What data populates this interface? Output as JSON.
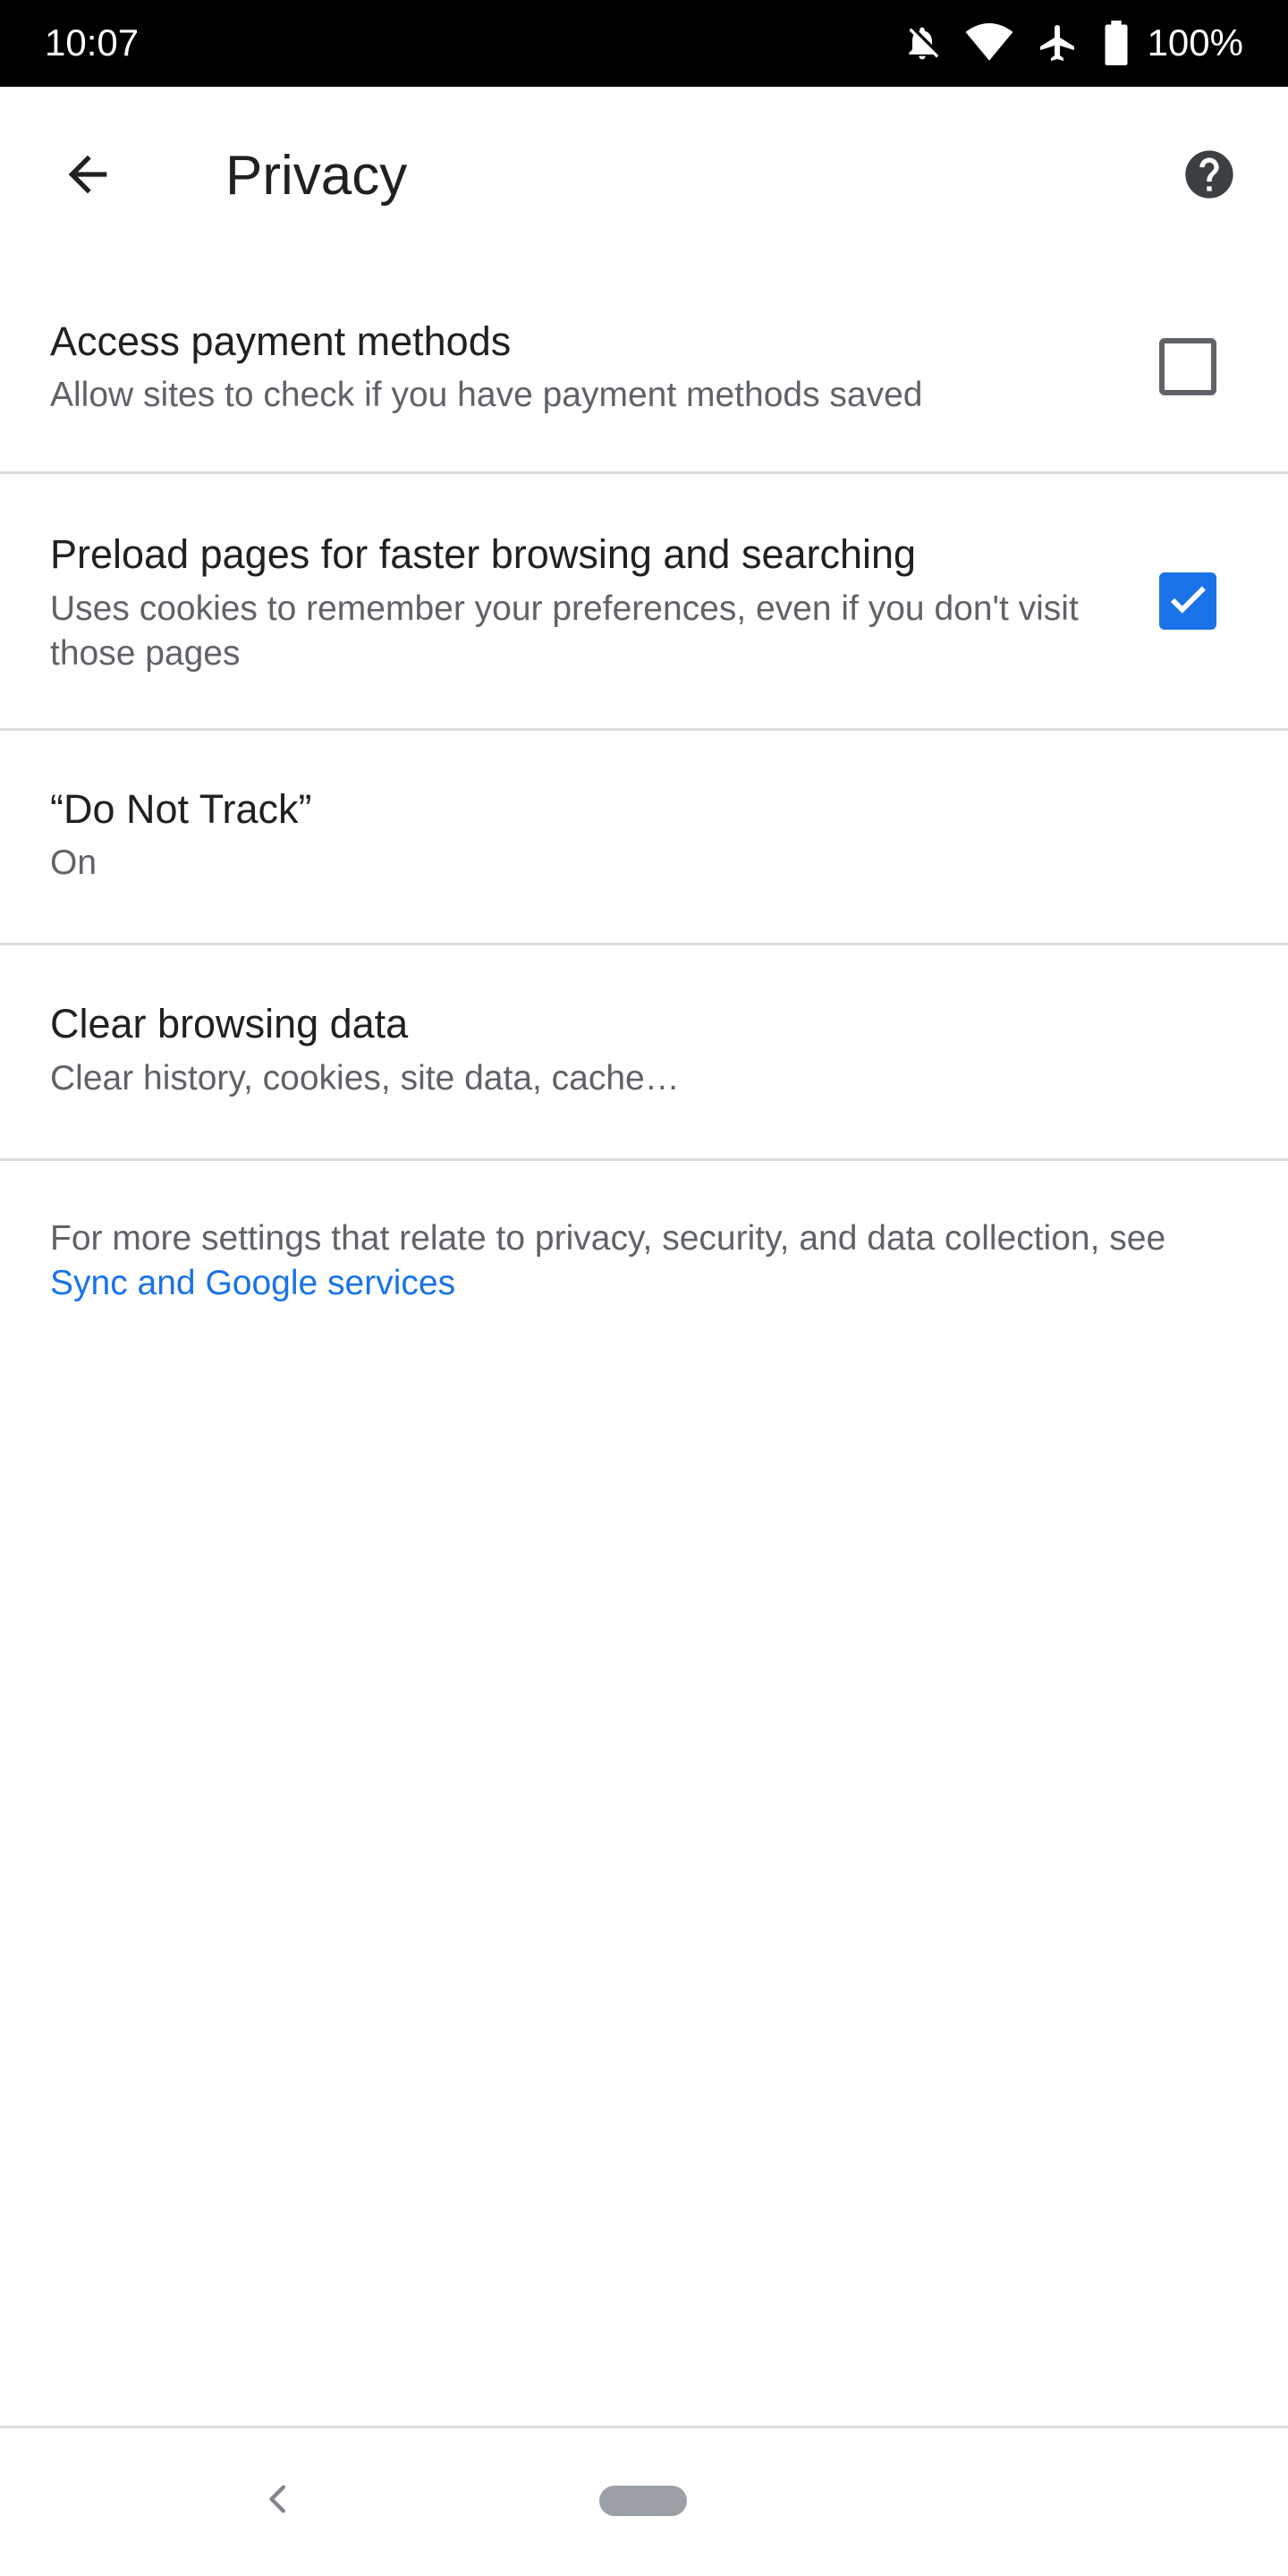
{
  "status_bar": {
    "time": "10:07",
    "battery_percent": "100%",
    "icons": [
      "notifications-off-icon",
      "wifi-icon",
      "airplane-icon",
      "battery-full-icon"
    ]
  },
  "app_bar": {
    "title": "Privacy",
    "back_icon": "arrow-back-icon",
    "help_icon": "help-icon"
  },
  "settings": {
    "payment_methods": {
      "title": "Access payment methods",
      "summary": "Allow sites to check if you have payment methods saved",
      "checked": false
    },
    "preload_pages": {
      "title": "Preload pages for faster browsing and searching",
      "summary": "Uses cookies to remember your preferences, even if you don't visit those pages",
      "checked": true
    },
    "do_not_track": {
      "title": "“Do Not Track”",
      "summary": "On"
    },
    "clear_browsing_data": {
      "title": "Clear browsing data",
      "summary": "Clear history, cookies, site data, cache…"
    }
  },
  "footer": {
    "text": "For more settings that relate to privacy, security, and data collection, see ",
    "link": "Sync and Google services"
  },
  "colors": {
    "accent": "#1a73e8",
    "text_primary": "#202124",
    "text_secondary": "#5f6368",
    "divider": "#dadce0"
  }
}
